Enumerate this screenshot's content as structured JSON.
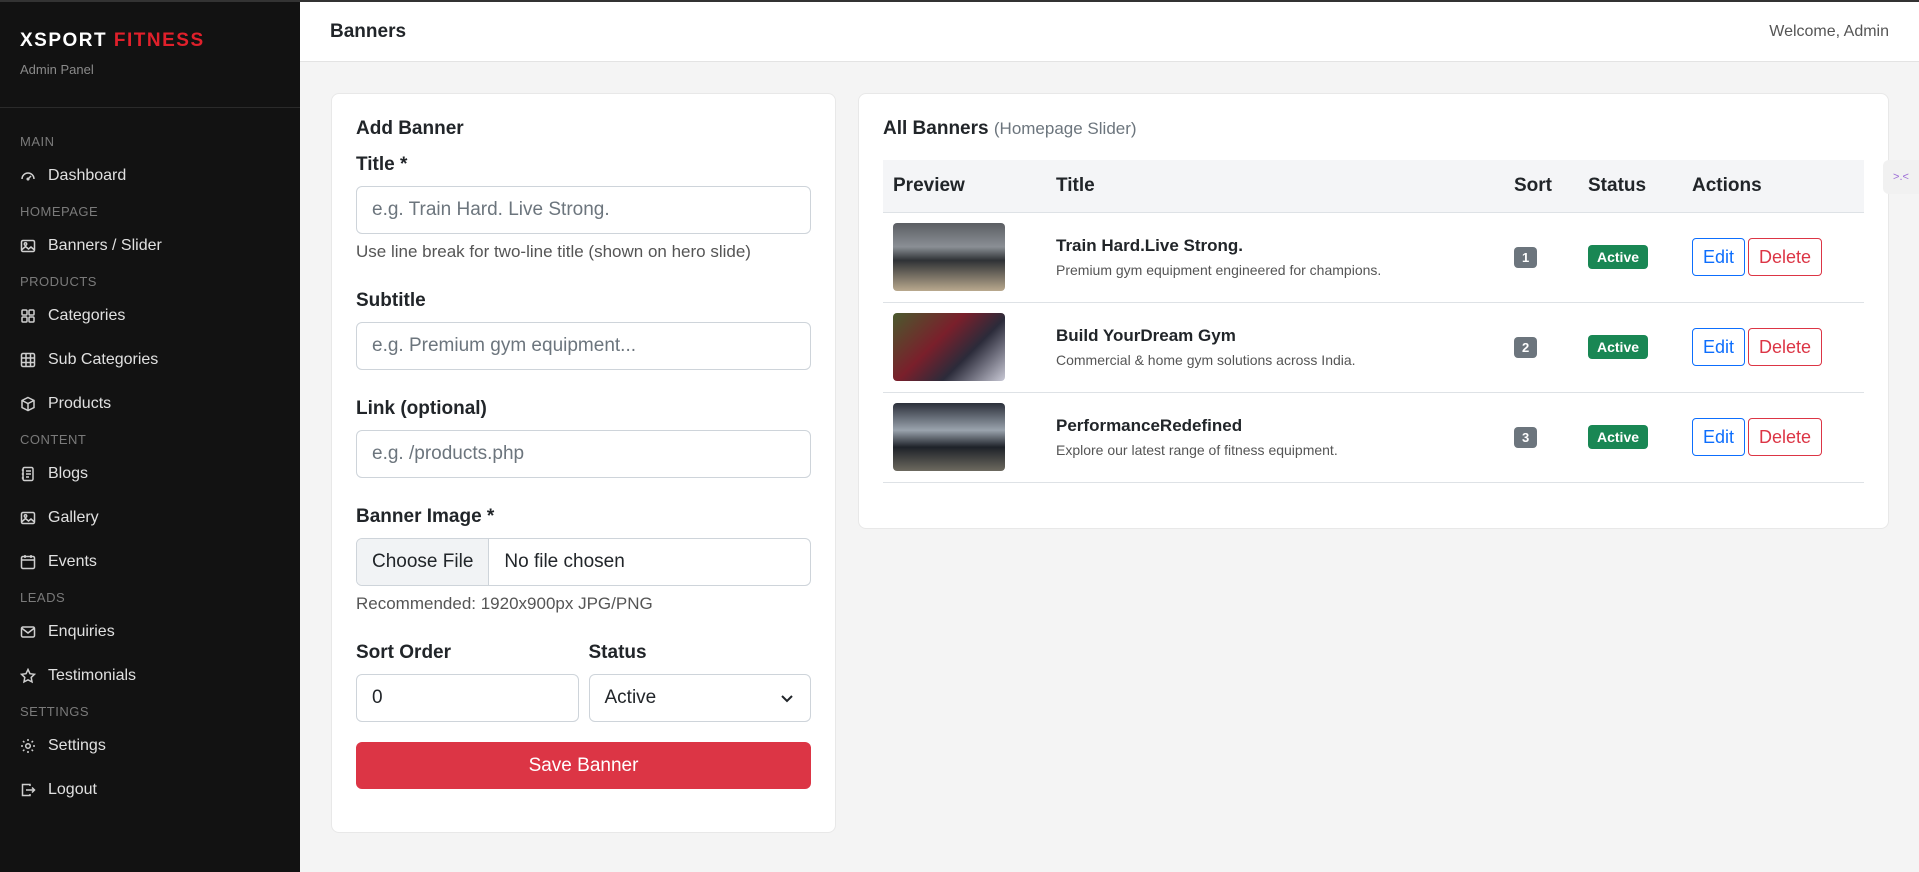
{
  "brand": {
    "name_part1": "XSPORT",
    "name_part2": "FITNESS",
    "subtitle": "Admin Panel"
  },
  "sidebar": [
    {
      "type": "section",
      "label": "MAIN"
    },
    {
      "type": "item",
      "label": "Dashboard",
      "icon": "speedometer-icon",
      "key": "dashboard"
    },
    {
      "type": "section",
      "label": "HOMEPAGE"
    },
    {
      "type": "item",
      "label": "Banners / Slider",
      "icon": "image-icon",
      "key": "banners"
    },
    {
      "type": "section",
      "label": "PRODUCTS"
    },
    {
      "type": "item",
      "label": "Categories",
      "icon": "grid-icon",
      "key": "categories"
    },
    {
      "type": "item",
      "label": "Sub Categories",
      "icon": "table-icon",
      "key": "sub-categories"
    },
    {
      "type": "item",
      "label": "Products",
      "icon": "box-icon",
      "key": "products"
    },
    {
      "type": "section",
      "label": "CONTENT"
    },
    {
      "type": "item",
      "label": "Blogs",
      "icon": "journal-icon",
      "key": "blogs"
    },
    {
      "type": "item",
      "label": "Gallery",
      "icon": "images-icon",
      "key": "gallery"
    },
    {
      "type": "item",
      "label": "Events",
      "icon": "calendar-icon",
      "key": "events"
    },
    {
      "type": "section",
      "label": "LEADS"
    },
    {
      "type": "item",
      "label": "Enquiries",
      "icon": "envelope-icon",
      "key": "enquiries"
    },
    {
      "type": "item",
      "label": "Testimonials",
      "icon": "star-icon",
      "key": "testimonials"
    },
    {
      "type": "section",
      "label": "SETTINGS"
    },
    {
      "type": "item",
      "label": "Settings",
      "icon": "gear-icon",
      "key": "settings"
    },
    {
      "type": "item",
      "label": "Logout",
      "icon": "logout-icon",
      "key": "logout"
    }
  ],
  "header": {
    "title": "Banners",
    "welcome": "Welcome, Admin"
  },
  "form": {
    "title": "Add Banner",
    "title_label": "Title *",
    "title_placeholder": "e.g. Train Hard. Live Strong.",
    "title_hint": "Use line break for two-line title (shown on hero slide)",
    "subtitle_label": "Subtitle",
    "subtitle_placeholder": "e.g. Premium gym equipment...",
    "link_label": "Link (optional)",
    "link_placeholder": "e.g. /products.php",
    "image_label": "Banner Image *",
    "file_button": "Choose File",
    "file_status": "No file chosen",
    "image_hint": "Recommended: 1920x900px JPG/PNG",
    "sort_label": "Sort Order",
    "sort_value": "0",
    "status_label": "Status",
    "status_value": "Active",
    "save_label": "Save Banner"
  },
  "list": {
    "title": "All Banners",
    "title_note": "(Homepage Slider)",
    "columns": [
      "Preview",
      "Title",
      "Sort",
      "Status",
      "Actions"
    ],
    "rows": [
      {
        "title": "Train Hard.Live Strong.",
        "subtitle": "Premium gym equipment engineered for champions.",
        "sort": "1",
        "status": "Active",
        "edit": "Edit",
        "delete": "Delete"
      },
      {
        "title": "Build YourDream Gym",
        "subtitle": "Commercial & home gym solutions across India.",
        "sort": "2",
        "status": "Active",
        "edit": "Edit",
        "delete": "Delete"
      },
      {
        "title": "PerformanceRedefined",
        "subtitle": "Explore our latest range of fitness equipment.",
        "sort": "3",
        "status": "Active",
        "edit": "Edit",
        "delete": "Delete"
      }
    ]
  },
  "side_tab": {
    "label": ">.<"
  }
}
